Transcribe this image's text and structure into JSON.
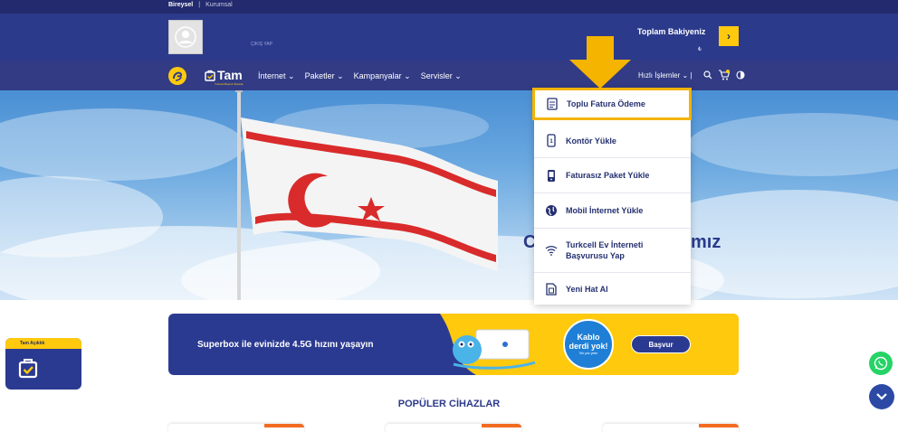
{
  "topbar": {
    "personal": "Bireysel",
    "separator": "|",
    "corporate": "Kurumsal"
  },
  "account": {
    "logout": "ÇIKIŞ YAP",
    "balance_label": "Toplam Bakiyeniz",
    "currency": "₺"
  },
  "nav": {
    "brand": "Tam",
    "brand_sub": "Turkcell Bayiniz Burada",
    "menu": [
      {
        "label": "İnternet ⌄"
      },
      {
        "label": "Paketler ⌄"
      },
      {
        "label": "Kampanyalar ⌄"
      },
      {
        "label": "Servisler ⌄"
      }
    ],
    "quick_actions": "Hızlı İşlemler ⌄ |"
  },
  "hero": {
    "text_left": "C",
    "text_right": "mız"
  },
  "dropdown": {
    "items": [
      {
        "label": "Toplu Fatura Ödeme",
        "icon": "invoice-icon"
      },
      {
        "label": "Kontör Yükle",
        "icon": "phone-credit-icon"
      },
      {
        "label": "Faturasız Paket Yükle",
        "icon": "phone-package-icon"
      },
      {
        "label": "Mobil İnternet Yükle",
        "icon": "globe-icon"
      },
      {
        "label": "Turkcell Ev İnterneti",
        "label2": "Başvurusu Yap",
        "icon": "wifi-icon"
      },
      {
        "label": "Yeni Hat Al",
        "icon": "sim-card-icon"
      }
    ]
  },
  "banner": {
    "text": "Superbox ile evinizde 4.5G hızını yaşayın",
    "badge_line1": "Kablo",
    "badge_line2": "derdi yok!",
    "badge_line3": "Tek priz yeter",
    "apply": "Başvur"
  },
  "popular": {
    "title": "POPÜLER CİHAZLAR"
  },
  "tam_widget": {
    "label": "Tam Açıklık"
  },
  "colors": {
    "navy": "#2c3a8c",
    "yellow": "#ffc90e",
    "orange": "#f36b21",
    "highlight": "#f4b400"
  }
}
